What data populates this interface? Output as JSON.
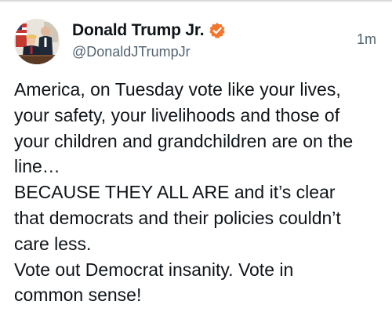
{
  "post": {
    "author": {
      "display_name": "Donald Trump Jr.",
      "handle": "@DonaldJTrumpJr",
      "verified": true,
      "avatar_icon": "profile-photo",
      "verified_icon": "verified-badge-icon",
      "badge_color": "#f4762e"
    },
    "timestamp": "1m",
    "text_lines": [
      "America, on Tuesday vote like your lives,",
      "your safety, your livelihoods and those of",
      "your children and grandchildren are on the",
      "line…",
      "BECAUSE THEY ALL ARE and it’s clear",
      "that democrats and their policies couldn’t",
      "care less.",
      "Vote out Democrat insanity. Vote in",
      "common sense!"
    ]
  }
}
